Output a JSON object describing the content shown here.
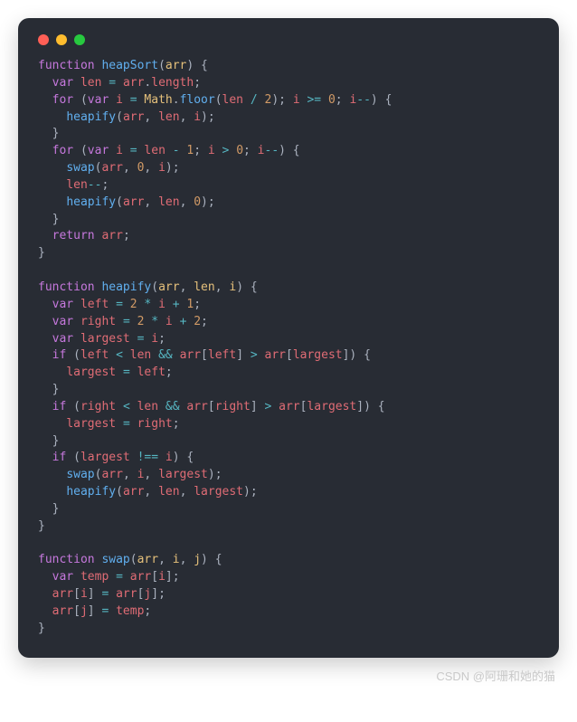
{
  "watermark": "CSDN @阿珊和她的猫",
  "code": {
    "tokens": [
      [
        [
          "kw",
          "function"
        ],
        [
          "punc",
          " "
        ],
        [
          "fn",
          "heapSort"
        ],
        [
          "punc",
          "("
        ],
        [
          "param",
          "arr"
        ],
        [
          "punc",
          ") {"
        ]
      ],
      [
        [
          "punc",
          "  "
        ],
        [
          "kw",
          "var"
        ],
        [
          "punc",
          " "
        ],
        [
          "ident",
          "len"
        ],
        [
          "punc",
          " "
        ],
        [
          "op",
          "="
        ],
        [
          "punc",
          " "
        ],
        [
          "ident",
          "arr"
        ],
        [
          "punc",
          "."
        ],
        [
          "prop",
          "length"
        ],
        [
          "punc",
          ";"
        ]
      ],
      [
        [
          "punc",
          "  "
        ],
        [
          "kw",
          "for"
        ],
        [
          "punc",
          " ("
        ],
        [
          "kw",
          "var"
        ],
        [
          "punc",
          " "
        ],
        [
          "ident",
          "i"
        ],
        [
          "punc",
          " "
        ],
        [
          "op",
          "="
        ],
        [
          "punc",
          " "
        ],
        [
          "obj",
          "Math"
        ],
        [
          "punc",
          "."
        ],
        [
          "fn",
          "floor"
        ],
        [
          "punc",
          "("
        ],
        [
          "ident",
          "len"
        ],
        [
          "punc",
          " "
        ],
        [
          "op",
          "/"
        ],
        [
          "punc",
          " "
        ],
        [
          "num",
          "2"
        ],
        [
          "punc",
          "); "
        ],
        [
          "ident",
          "i"
        ],
        [
          "punc",
          " "
        ],
        [
          "op",
          ">="
        ],
        [
          "punc",
          " "
        ],
        [
          "num",
          "0"
        ],
        [
          "punc",
          "; "
        ],
        [
          "ident",
          "i"
        ],
        [
          "op",
          "--"
        ],
        [
          "punc",
          ") {"
        ]
      ],
      [
        [
          "punc",
          "    "
        ],
        [
          "fn",
          "heapify"
        ],
        [
          "punc",
          "("
        ],
        [
          "ident",
          "arr"
        ],
        [
          "punc",
          ", "
        ],
        [
          "ident",
          "len"
        ],
        [
          "punc",
          ", "
        ],
        [
          "ident",
          "i"
        ],
        [
          "punc",
          ");"
        ]
      ],
      [
        [
          "punc",
          "  }"
        ]
      ],
      [
        [
          "punc",
          "  "
        ],
        [
          "kw",
          "for"
        ],
        [
          "punc",
          " ("
        ],
        [
          "kw",
          "var"
        ],
        [
          "punc",
          " "
        ],
        [
          "ident",
          "i"
        ],
        [
          "punc",
          " "
        ],
        [
          "op",
          "="
        ],
        [
          "punc",
          " "
        ],
        [
          "ident",
          "len"
        ],
        [
          "punc",
          " "
        ],
        [
          "op",
          "-"
        ],
        [
          "punc",
          " "
        ],
        [
          "num",
          "1"
        ],
        [
          "punc",
          "; "
        ],
        [
          "ident",
          "i"
        ],
        [
          "punc",
          " "
        ],
        [
          "op",
          ">"
        ],
        [
          "punc",
          " "
        ],
        [
          "num",
          "0"
        ],
        [
          "punc",
          "; "
        ],
        [
          "ident",
          "i"
        ],
        [
          "op",
          "--"
        ],
        [
          "punc",
          ") {"
        ]
      ],
      [
        [
          "punc",
          "    "
        ],
        [
          "fn",
          "swap"
        ],
        [
          "punc",
          "("
        ],
        [
          "ident",
          "arr"
        ],
        [
          "punc",
          ", "
        ],
        [
          "num",
          "0"
        ],
        [
          "punc",
          ", "
        ],
        [
          "ident",
          "i"
        ],
        [
          "punc",
          ");"
        ]
      ],
      [
        [
          "punc",
          "    "
        ],
        [
          "ident",
          "len"
        ],
        [
          "op",
          "--"
        ],
        [
          "punc",
          ";"
        ]
      ],
      [
        [
          "punc",
          "    "
        ],
        [
          "fn",
          "heapify"
        ],
        [
          "punc",
          "("
        ],
        [
          "ident",
          "arr"
        ],
        [
          "punc",
          ", "
        ],
        [
          "ident",
          "len"
        ],
        [
          "punc",
          ", "
        ],
        [
          "num",
          "0"
        ],
        [
          "punc",
          ");"
        ]
      ],
      [
        [
          "punc",
          "  }"
        ]
      ],
      [
        [
          "punc",
          "  "
        ],
        [
          "kw",
          "return"
        ],
        [
          "punc",
          " "
        ],
        [
          "ident",
          "arr"
        ],
        [
          "punc",
          ";"
        ]
      ],
      [
        [
          "punc",
          "}"
        ]
      ],
      [
        [
          "punc",
          ""
        ]
      ],
      [
        [
          "kw",
          "function"
        ],
        [
          "punc",
          " "
        ],
        [
          "fn",
          "heapify"
        ],
        [
          "punc",
          "("
        ],
        [
          "param",
          "arr"
        ],
        [
          "punc",
          ", "
        ],
        [
          "param",
          "len"
        ],
        [
          "punc",
          ", "
        ],
        [
          "param",
          "i"
        ],
        [
          "punc",
          ") {"
        ]
      ],
      [
        [
          "punc",
          "  "
        ],
        [
          "kw",
          "var"
        ],
        [
          "punc",
          " "
        ],
        [
          "ident",
          "left"
        ],
        [
          "punc",
          " "
        ],
        [
          "op",
          "="
        ],
        [
          "punc",
          " "
        ],
        [
          "num",
          "2"
        ],
        [
          "punc",
          " "
        ],
        [
          "op",
          "*"
        ],
        [
          "punc",
          " "
        ],
        [
          "ident",
          "i"
        ],
        [
          "punc",
          " "
        ],
        [
          "op",
          "+"
        ],
        [
          "punc",
          " "
        ],
        [
          "num",
          "1"
        ],
        [
          "punc",
          ";"
        ]
      ],
      [
        [
          "punc",
          "  "
        ],
        [
          "kw",
          "var"
        ],
        [
          "punc",
          " "
        ],
        [
          "ident",
          "right"
        ],
        [
          "punc",
          " "
        ],
        [
          "op",
          "="
        ],
        [
          "punc",
          " "
        ],
        [
          "num",
          "2"
        ],
        [
          "punc",
          " "
        ],
        [
          "op",
          "*"
        ],
        [
          "punc",
          " "
        ],
        [
          "ident",
          "i"
        ],
        [
          "punc",
          " "
        ],
        [
          "op",
          "+"
        ],
        [
          "punc",
          " "
        ],
        [
          "num",
          "2"
        ],
        [
          "punc",
          ";"
        ]
      ],
      [
        [
          "punc",
          "  "
        ],
        [
          "kw",
          "var"
        ],
        [
          "punc",
          " "
        ],
        [
          "ident",
          "largest"
        ],
        [
          "punc",
          " "
        ],
        [
          "op",
          "="
        ],
        [
          "punc",
          " "
        ],
        [
          "ident",
          "i"
        ],
        [
          "punc",
          ";"
        ]
      ],
      [
        [
          "punc",
          "  "
        ],
        [
          "kw",
          "if"
        ],
        [
          "punc",
          " ("
        ],
        [
          "ident",
          "left"
        ],
        [
          "punc",
          " "
        ],
        [
          "op",
          "<"
        ],
        [
          "punc",
          " "
        ],
        [
          "ident",
          "len"
        ],
        [
          "punc",
          " "
        ],
        [
          "op",
          "&&"
        ],
        [
          "punc",
          " "
        ],
        [
          "ident",
          "arr"
        ],
        [
          "punc",
          "["
        ],
        [
          "ident",
          "left"
        ],
        [
          "punc",
          "] "
        ],
        [
          "op",
          ">"
        ],
        [
          "punc",
          " "
        ],
        [
          "ident",
          "arr"
        ],
        [
          "punc",
          "["
        ],
        [
          "ident",
          "largest"
        ],
        [
          "punc",
          "]) {"
        ]
      ],
      [
        [
          "punc",
          "    "
        ],
        [
          "ident",
          "largest"
        ],
        [
          "punc",
          " "
        ],
        [
          "op",
          "="
        ],
        [
          "punc",
          " "
        ],
        [
          "ident",
          "left"
        ],
        [
          "punc",
          ";"
        ]
      ],
      [
        [
          "punc",
          "  }"
        ]
      ],
      [
        [
          "punc",
          "  "
        ],
        [
          "kw",
          "if"
        ],
        [
          "punc",
          " ("
        ],
        [
          "ident",
          "right"
        ],
        [
          "punc",
          " "
        ],
        [
          "op",
          "<"
        ],
        [
          "punc",
          " "
        ],
        [
          "ident",
          "len"
        ],
        [
          "punc",
          " "
        ],
        [
          "op",
          "&&"
        ],
        [
          "punc",
          " "
        ],
        [
          "ident",
          "arr"
        ],
        [
          "punc",
          "["
        ],
        [
          "ident",
          "right"
        ],
        [
          "punc",
          "] "
        ],
        [
          "op",
          ">"
        ],
        [
          "punc",
          " "
        ],
        [
          "ident",
          "arr"
        ],
        [
          "punc",
          "["
        ],
        [
          "ident",
          "largest"
        ],
        [
          "punc",
          "]) {"
        ]
      ],
      [
        [
          "punc",
          "    "
        ],
        [
          "ident",
          "largest"
        ],
        [
          "punc",
          " "
        ],
        [
          "op",
          "="
        ],
        [
          "punc",
          " "
        ],
        [
          "ident",
          "right"
        ],
        [
          "punc",
          ";"
        ]
      ],
      [
        [
          "punc",
          "  }"
        ]
      ],
      [
        [
          "punc",
          "  "
        ],
        [
          "kw",
          "if"
        ],
        [
          "punc",
          " ("
        ],
        [
          "ident",
          "largest"
        ],
        [
          "punc",
          " "
        ],
        [
          "op",
          "!=="
        ],
        [
          "punc",
          " "
        ],
        [
          "ident",
          "i"
        ],
        [
          "punc",
          ") {"
        ]
      ],
      [
        [
          "punc",
          "    "
        ],
        [
          "fn",
          "swap"
        ],
        [
          "punc",
          "("
        ],
        [
          "ident",
          "arr"
        ],
        [
          "punc",
          ", "
        ],
        [
          "ident",
          "i"
        ],
        [
          "punc",
          ", "
        ],
        [
          "ident",
          "largest"
        ],
        [
          "punc",
          ");"
        ]
      ],
      [
        [
          "punc",
          "    "
        ],
        [
          "fn",
          "heapify"
        ],
        [
          "punc",
          "("
        ],
        [
          "ident",
          "arr"
        ],
        [
          "punc",
          ", "
        ],
        [
          "ident",
          "len"
        ],
        [
          "punc",
          ", "
        ],
        [
          "ident",
          "largest"
        ],
        [
          "punc",
          ");"
        ]
      ],
      [
        [
          "punc",
          "  }"
        ]
      ],
      [
        [
          "punc",
          "}"
        ]
      ],
      [
        [
          "punc",
          ""
        ]
      ],
      [
        [
          "kw",
          "function"
        ],
        [
          "punc",
          " "
        ],
        [
          "fn",
          "swap"
        ],
        [
          "punc",
          "("
        ],
        [
          "param",
          "arr"
        ],
        [
          "punc",
          ", "
        ],
        [
          "param",
          "i"
        ],
        [
          "punc",
          ", "
        ],
        [
          "param",
          "j"
        ],
        [
          "punc",
          ") {"
        ]
      ],
      [
        [
          "punc",
          "  "
        ],
        [
          "kw",
          "var"
        ],
        [
          "punc",
          " "
        ],
        [
          "ident",
          "temp"
        ],
        [
          "punc",
          " "
        ],
        [
          "op",
          "="
        ],
        [
          "punc",
          " "
        ],
        [
          "ident",
          "arr"
        ],
        [
          "punc",
          "["
        ],
        [
          "ident",
          "i"
        ],
        [
          "punc",
          "];"
        ]
      ],
      [
        [
          "punc",
          "  "
        ],
        [
          "ident",
          "arr"
        ],
        [
          "punc",
          "["
        ],
        [
          "ident",
          "i"
        ],
        [
          "punc",
          "] "
        ],
        [
          "op",
          "="
        ],
        [
          "punc",
          " "
        ],
        [
          "ident",
          "arr"
        ],
        [
          "punc",
          "["
        ],
        [
          "ident",
          "j"
        ],
        [
          "punc",
          "];"
        ]
      ],
      [
        [
          "punc",
          "  "
        ],
        [
          "ident",
          "arr"
        ],
        [
          "punc",
          "["
        ],
        [
          "ident",
          "j"
        ],
        [
          "punc",
          "] "
        ],
        [
          "op",
          "="
        ],
        [
          "punc",
          " "
        ],
        [
          "ident",
          "temp"
        ],
        [
          "punc",
          ";"
        ]
      ],
      [
        [
          "punc",
          "}"
        ]
      ]
    ]
  }
}
